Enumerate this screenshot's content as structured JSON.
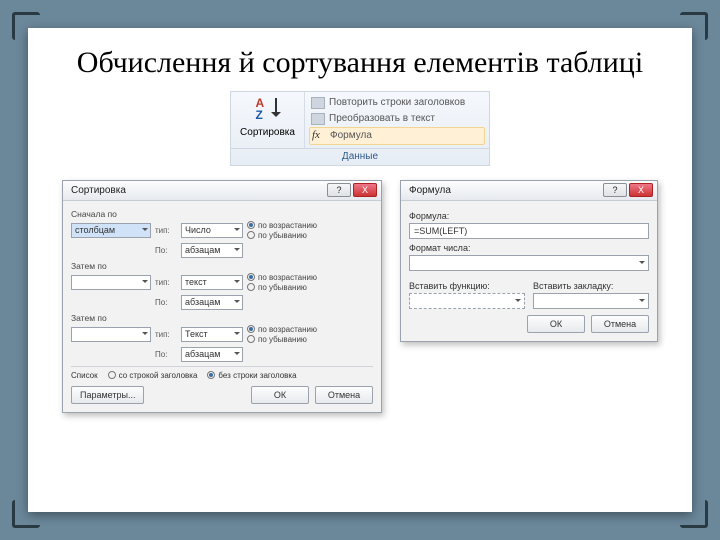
{
  "slide": {
    "title": "Обчислення й сортування елементів таблиці"
  },
  "ribbon": {
    "sort_label": "Сортировка",
    "items": {
      "repeat_headers": "Повторить строки заголовков",
      "convert_to_text": "Преобразовать в текст",
      "formula": "Формула"
    },
    "fx_symbol": "fx",
    "group_caption": "Данные"
  },
  "dialog_sort": {
    "title": "Сортировка",
    "help_icon": "?",
    "close_icon": "X",
    "section_first": "Сначала по",
    "section_then1": "Затем по",
    "section_then2": "Затем по",
    "combo_first": "столбцам",
    "label_type": "тип:",
    "label_by": "По:",
    "type_number": "Число",
    "type_text": "текст",
    "type_text2": "Текст",
    "by_paragraphs": "абзацам",
    "radio_asc": "по возрастанию",
    "radio_desc": "по убыванию",
    "headers_label": "Список",
    "headers_with": "со строкой заголовка",
    "headers_without": "без строки заголовка",
    "btn_params": "Параметры...",
    "btn_ok": "ОК",
    "btn_cancel": "Отмена"
  },
  "dialog_formula": {
    "title": "Формула",
    "help_icon": "?",
    "close_icon": "X",
    "label_formula": "Формула:",
    "formula_value": "=SUM(LEFT)",
    "label_format": "Формат числа:",
    "label_insert_fn": "Вставить функцию:",
    "label_insert_bm": "Вставить закладку:",
    "btn_ok": "ОК",
    "btn_cancel": "Отмена"
  }
}
